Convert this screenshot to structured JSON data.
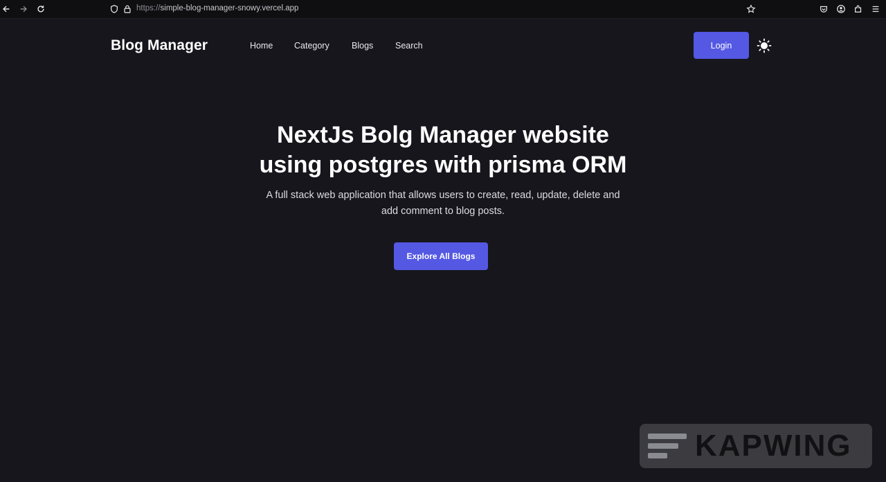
{
  "browser": {
    "url_protocol": "https://",
    "url_host": "simple-blog-manager-snowy.vercel.app"
  },
  "navbar": {
    "brand": "Blog Manager",
    "links": [
      "Home",
      "Category",
      "Blogs",
      "Search"
    ],
    "login_label": "Login",
    "theme_icon": "sun-icon"
  },
  "hero": {
    "title_line1": "NextJs Bolg Manager website",
    "title_line2": "using postgres with prisma ORM",
    "subtitle_line1": "A full stack web application that allows users to create, read, update, delete and",
    "subtitle_line2": "add comment to blog posts.",
    "cta_label": "Explore All Blogs"
  },
  "watermark": {
    "text": "KAPWING"
  },
  "colors": {
    "background": "#17161c",
    "accent": "#5458e3",
    "text": "#ffffff"
  }
}
